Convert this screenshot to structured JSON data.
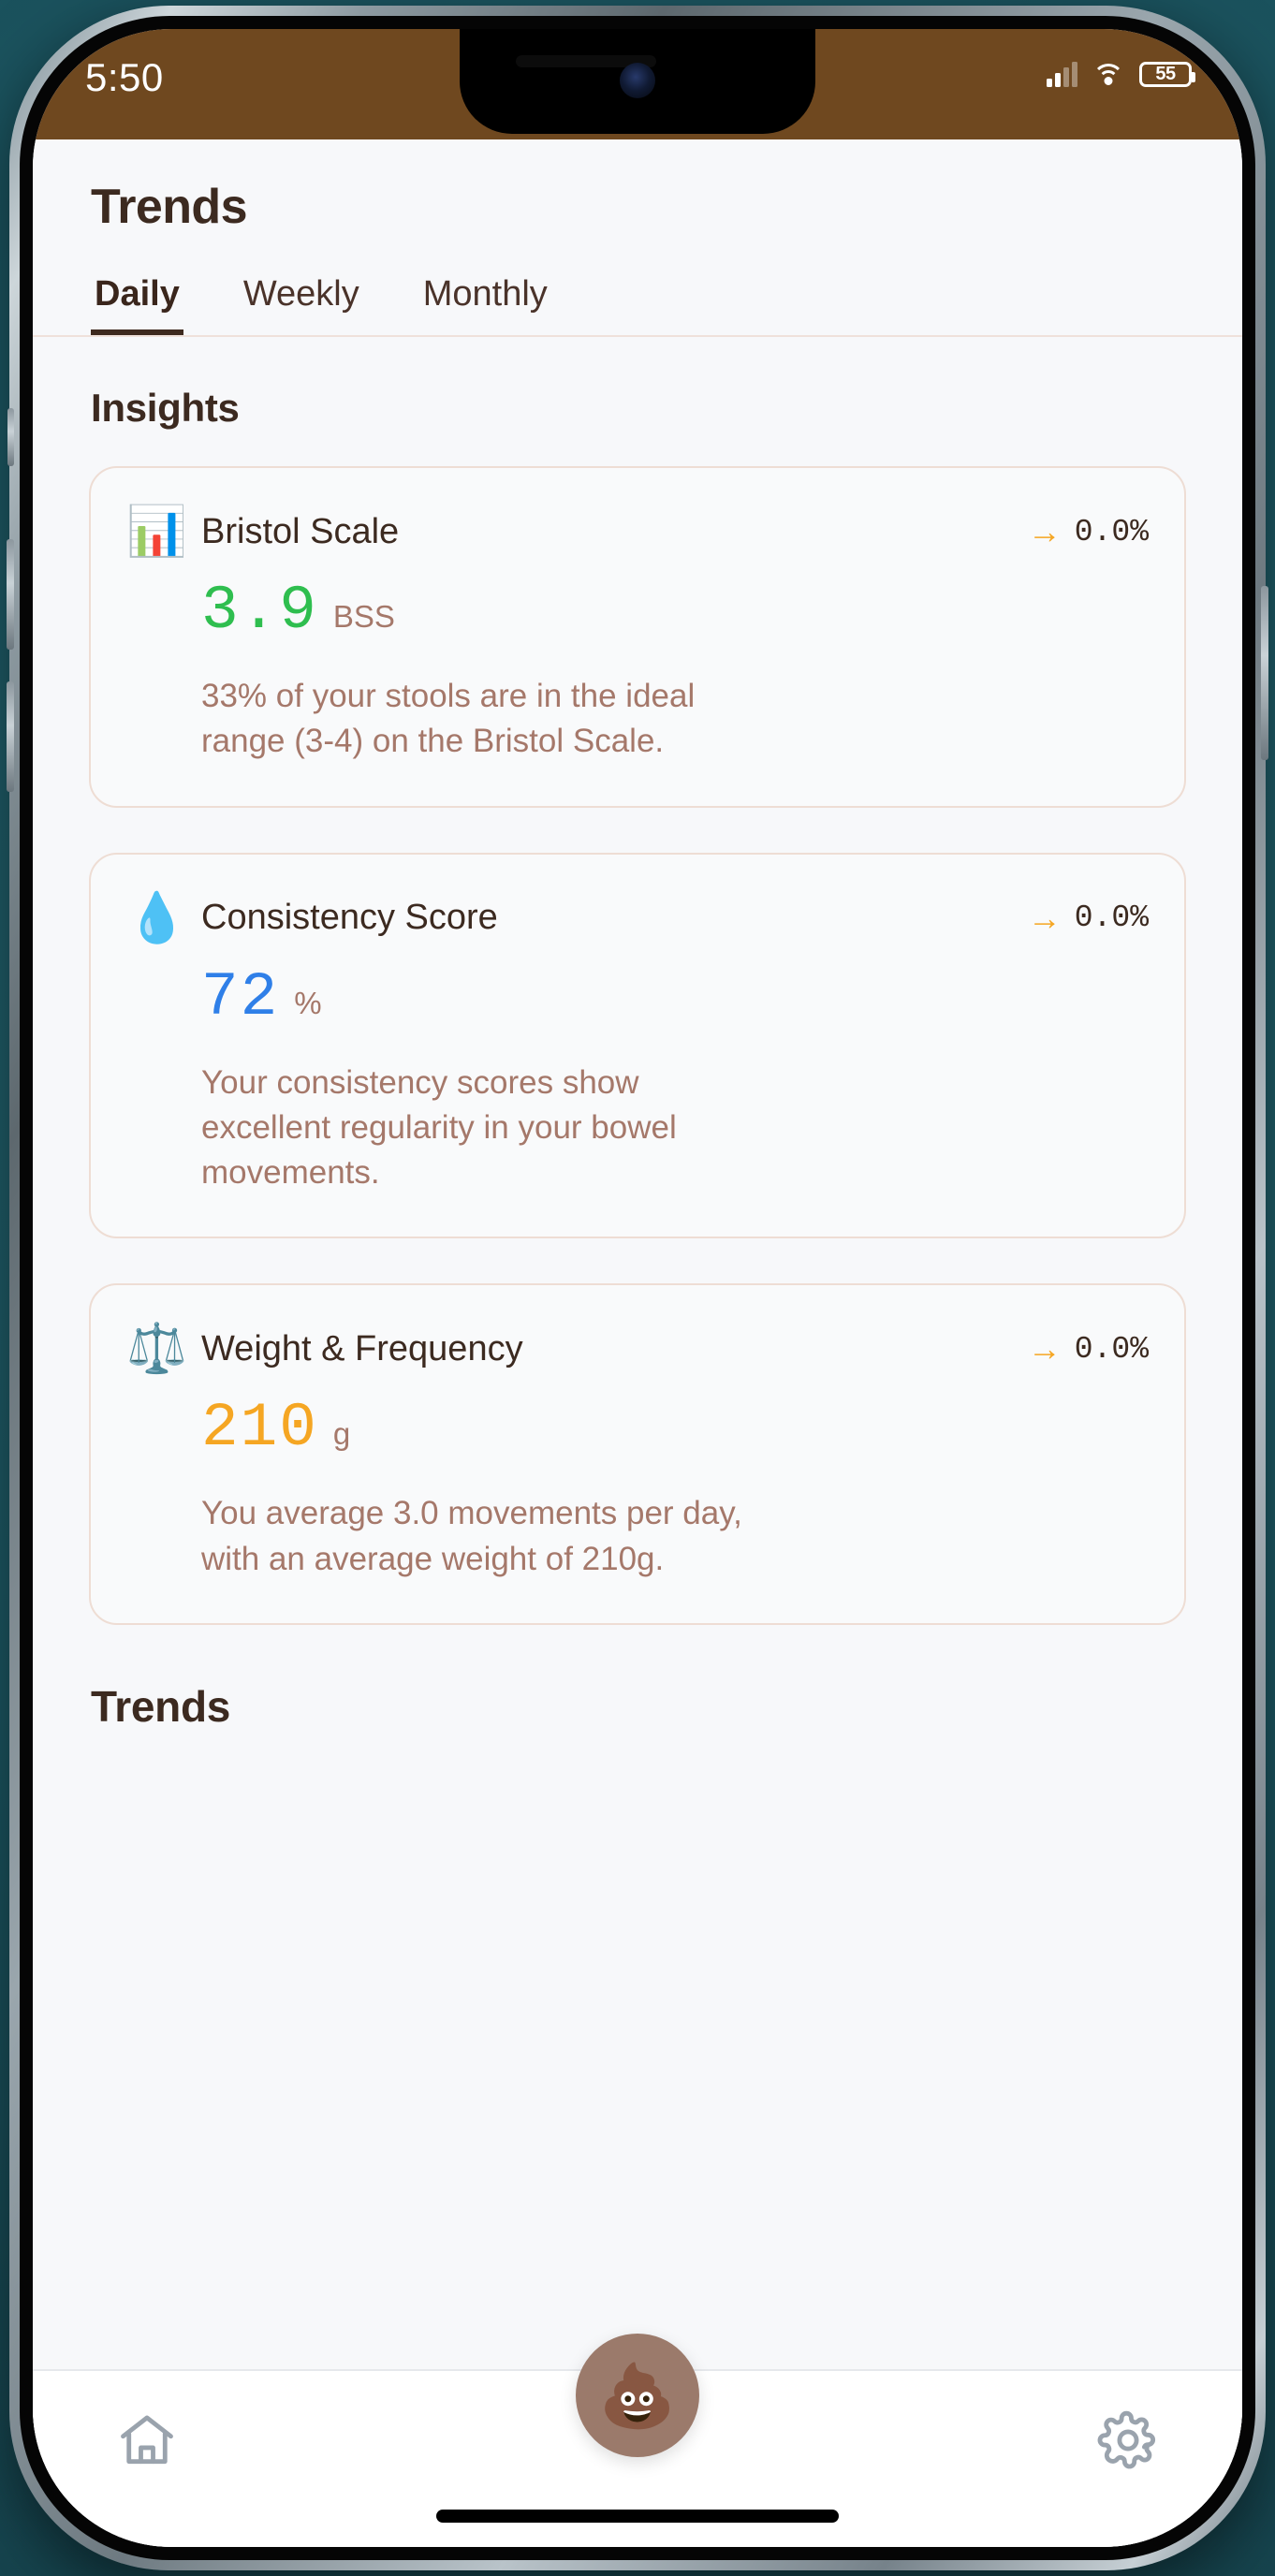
{
  "status_bar": {
    "time": "5:50",
    "battery_level": "55",
    "signal_icon": "cellular-signal-icon",
    "wifi_icon": "wifi-icon",
    "battery_icon": "battery-icon",
    "background_color": "#6f481f"
  },
  "header": {
    "title": "Trends"
  },
  "tabs": [
    {
      "label": "Daily",
      "active": true
    },
    {
      "label": "Weekly",
      "active": false
    },
    {
      "label": "Monthly",
      "active": false
    }
  ],
  "sections": {
    "insights_heading": "Insights",
    "trends_heading": "Trends"
  },
  "insight_cards": [
    {
      "icon": "bar-chart-emoji",
      "emoji": "📊",
      "title": "Bristol Scale",
      "trend_arrow": "→",
      "trend_value": "0.0%",
      "value": "3.9",
      "value_color": "#2fbe4f",
      "unit": "BSS",
      "description": "33% of your stools are in the ideal range (3-4) on the Bristol Scale."
    },
    {
      "icon": "droplet-emoji",
      "emoji": "💧",
      "title": "Consistency Score",
      "trend_arrow": "→",
      "trend_value": "0.0%",
      "value": "72",
      "value_color": "#2f7fe8",
      "unit": "%",
      "description": "Your consistency scores show excellent regularity in your bowel movements."
    },
    {
      "icon": "balance-scale-emoji",
      "emoji": "⚖️",
      "title": "Weight & Frequency",
      "trend_arrow": "→",
      "trend_value": "0.0%",
      "value": "210",
      "value_color": "#f5a623",
      "unit": "g",
      "description": "You average 3.0 movements per day, with an average weight of 210g."
    }
  ],
  "bottom_nav": {
    "home_icon": "home-icon",
    "settings_icon": "gear-icon",
    "fab_emoji": "💩",
    "fab_icon": "poop-emoji",
    "fab_color": "#9b7a6b"
  }
}
